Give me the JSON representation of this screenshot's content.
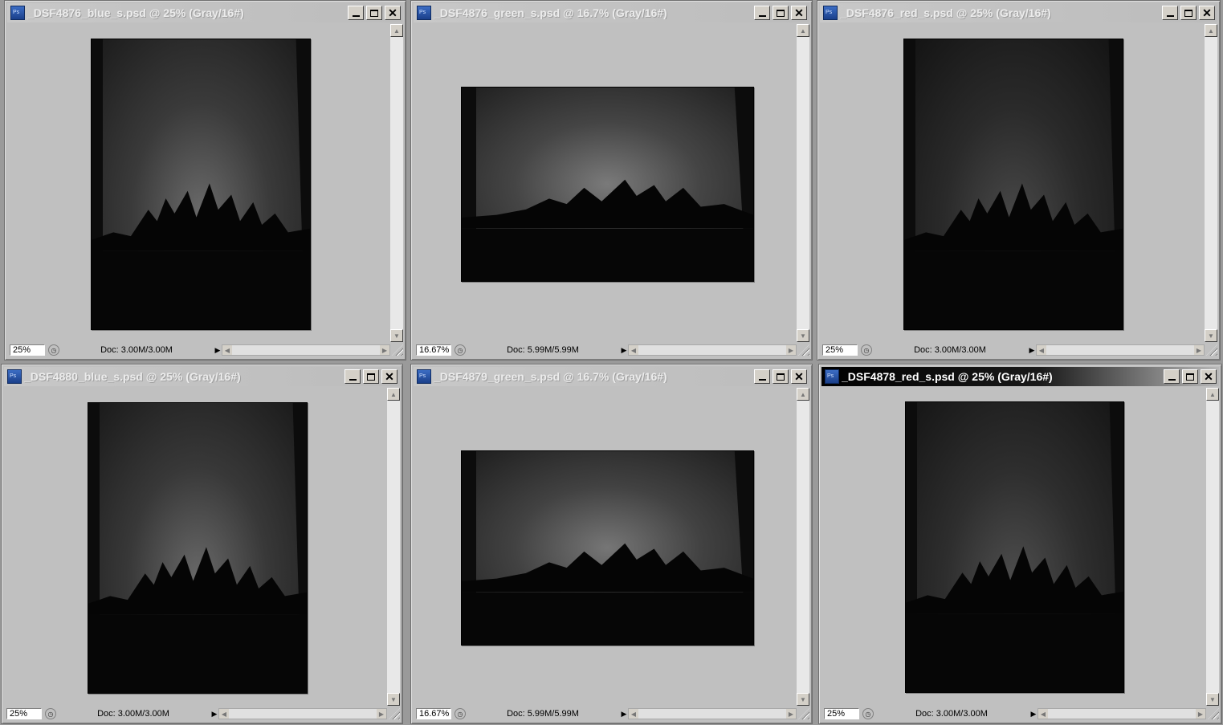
{
  "windows": [
    {
      "title": "_DSF4876_blue_s.psd @ 25% (Gray/16#)",
      "zoom": "25%",
      "doc": "Doc: 3.00M/3.00M",
      "active": false,
      "orientation": "portrait"
    },
    {
      "title": "_DSF4876_green_s.psd @ 16.7% (Gray/16#)",
      "zoom": "16.67%",
      "doc": "Doc: 5.99M/5.99M",
      "active": false,
      "orientation": "landscape"
    },
    {
      "title": "_DSF4876_red_s.psd @ 25% (Gray/16#)",
      "zoom": "25%",
      "doc": "Doc: 3.00M/3.00M",
      "active": false,
      "orientation": "portrait"
    },
    {
      "title": "_DSF4880_blue_s.psd @ 25% (Gray/16#)",
      "zoom": "25%",
      "doc": "Doc: 3.00M/3.00M",
      "active": false,
      "orientation": "portrait"
    },
    {
      "title": "_DSF4879_green_s.psd @ 16.7% (Gray/16#)",
      "zoom": "16.67%",
      "doc": "Doc: 5.99M/5.99M",
      "active": false,
      "orientation": "landscape"
    },
    {
      "title": "_DSF4878_red_s.psd @ 25% (Gray/16#)",
      "zoom": "25%",
      "doc": "Doc: 3.00M/3.00M",
      "active": true,
      "orientation": "portrait"
    }
  ],
  "icons": {
    "app": "photoshop-icon",
    "minimize": "minimize-icon",
    "maximize": "maximize-icon",
    "close": "close-icon",
    "navigator": "navigator-icon"
  },
  "colors": {
    "canvas_bg": "#c0c0c0",
    "active_title": "#000000",
    "inactive_title_text": "#ececec"
  }
}
